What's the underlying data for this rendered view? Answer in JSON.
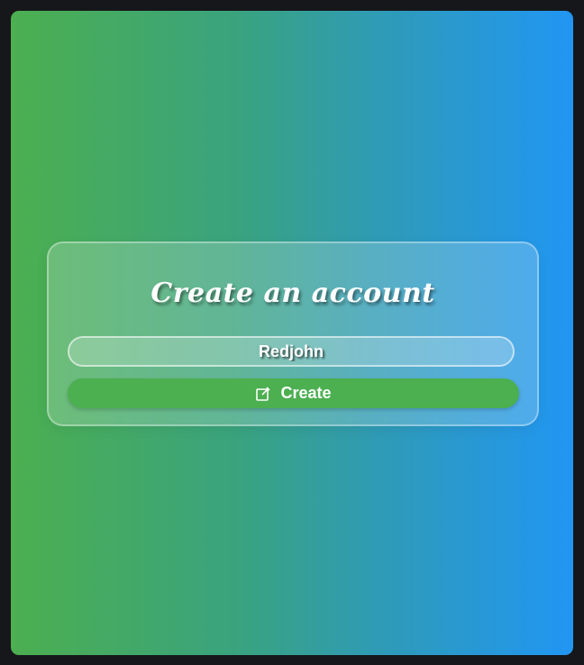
{
  "form": {
    "title": "Create an account",
    "name_value": "Redjohn",
    "create_label": "Create"
  },
  "colors": {
    "gradient_start": "#4caf50",
    "gradient_end": "#2196f3",
    "button": "#4caf50"
  },
  "icons": {
    "create": "edit-icon"
  }
}
